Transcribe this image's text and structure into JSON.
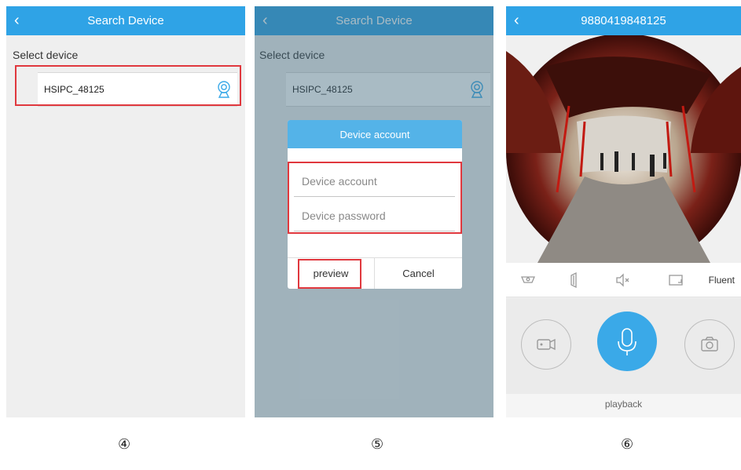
{
  "screen4": {
    "title": "Search Device",
    "section_label": "Select device",
    "device_name": "HSIPC_48125",
    "step_marker": "④"
  },
  "screen5": {
    "title": "Search Device",
    "section_label": "Select device",
    "device_name": "HSIPC_48125",
    "dialog": {
      "title": "Device account",
      "account_placeholder": "Device account",
      "password_placeholder": "Device password",
      "preview_label": "preview",
      "cancel_label": "Cancel"
    },
    "step_marker": "⑤"
  },
  "screen6": {
    "title": "9880419848125",
    "toolbar": {
      "icons": [
        "fisheye-icon",
        "speaker-icon",
        "mute-icon",
        "fullscreen-icon"
      ],
      "quality_label": "Fluent"
    },
    "controls": [
      "record-icon",
      "microphone-icon",
      "snapshot-icon"
    ],
    "playback_label": "playback",
    "step_marker": "⑥"
  },
  "colors": {
    "titlebar": "#2fa3e6",
    "dialog_header": "#54b3e8",
    "highlight": "#e0383e",
    "mic_button": "#3aa9e8"
  }
}
